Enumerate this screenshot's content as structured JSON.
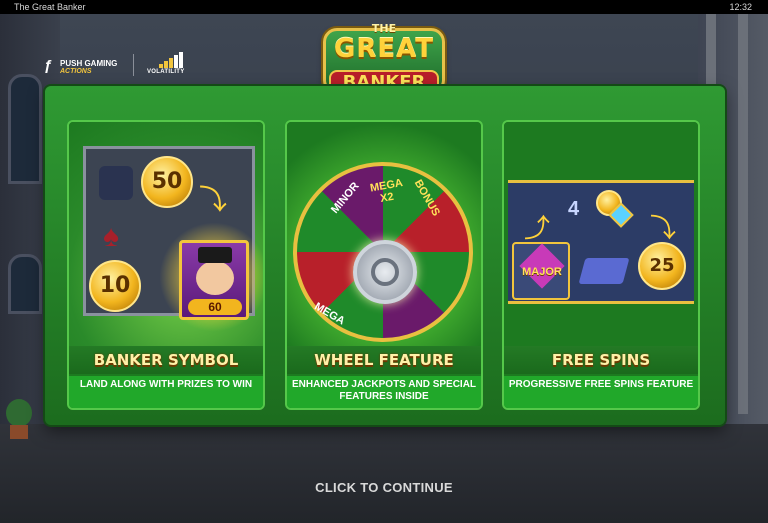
{
  "titlebar": {
    "title": "The Great Banker",
    "clock": "12:32"
  },
  "logo": {
    "the": "THE",
    "great": "GREAT",
    "banker": "BANKER"
  },
  "studio": {
    "name": "PUSH GAMING",
    "sub": "ACTIONS",
    "icon": "push-gaming-icon"
  },
  "volatility": {
    "label": "VOLATILITY",
    "level": 3,
    "max": 5
  },
  "cards": [
    {
      "title": "BANKER SYMBOL",
      "description": "LAND ALONG WITH PRIZES TO WIN",
      "coins": [
        "50",
        "10"
      ],
      "banker_value": "60"
    },
    {
      "title": "WHEEL FEATURE",
      "description": "ENHANCED JACKPOTS AND SPECIAL FEATURES INSIDE",
      "segments": [
        "MINOR",
        "MEGA X2",
        "BONUS",
        "MEGA"
      ]
    },
    {
      "title": "FREE SPINS",
      "description": "PROGRESSIVE FREE SPINS FEATURE",
      "major_label": "MAJOR",
      "counter": "4",
      "coin": "25"
    }
  ],
  "continue_label": "CLICK TO CONTINUE",
  "colors": {
    "panel": "#2f9a33",
    "gold": "#f2b51e",
    "title_text": "#fff1a8"
  }
}
